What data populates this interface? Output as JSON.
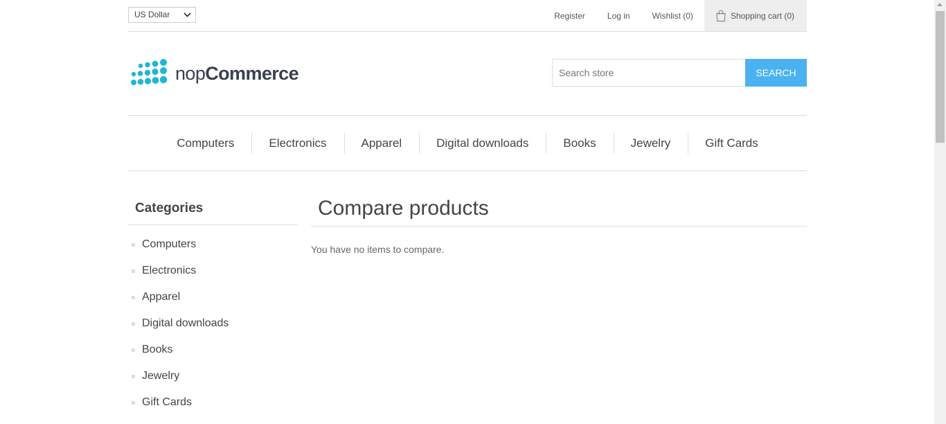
{
  "header": {
    "currency": "US Dollar",
    "links": {
      "register": "Register",
      "login": "Log in",
      "wishlist": "Wishlist (0)",
      "cart": "Shopping cart (0)"
    }
  },
  "logo": {
    "prefix": "nop",
    "brand": "Commerce"
  },
  "search": {
    "placeholder": "Search store",
    "button": "SEARCH"
  },
  "top_menu": [
    "Computers",
    "Electronics",
    "Apparel",
    "Digital downloads",
    "Books",
    "Jewelry",
    "Gift Cards"
  ],
  "sidebar": {
    "title": "Categories",
    "items": [
      "Computers",
      "Electronics",
      "Apparel",
      "Digital downloads",
      "Books",
      "Jewelry",
      "Gift Cards"
    ]
  },
  "main": {
    "title": "Compare products",
    "message": "You have no items to compare."
  },
  "colors": {
    "accent": "#4ab2f1",
    "logo_dots": "#1fb6d4",
    "logo_text": "#3a3f51"
  },
  "icons": {
    "cart": "shopping-bag-icon",
    "currency_dropdown": "chevron-down-icon"
  }
}
